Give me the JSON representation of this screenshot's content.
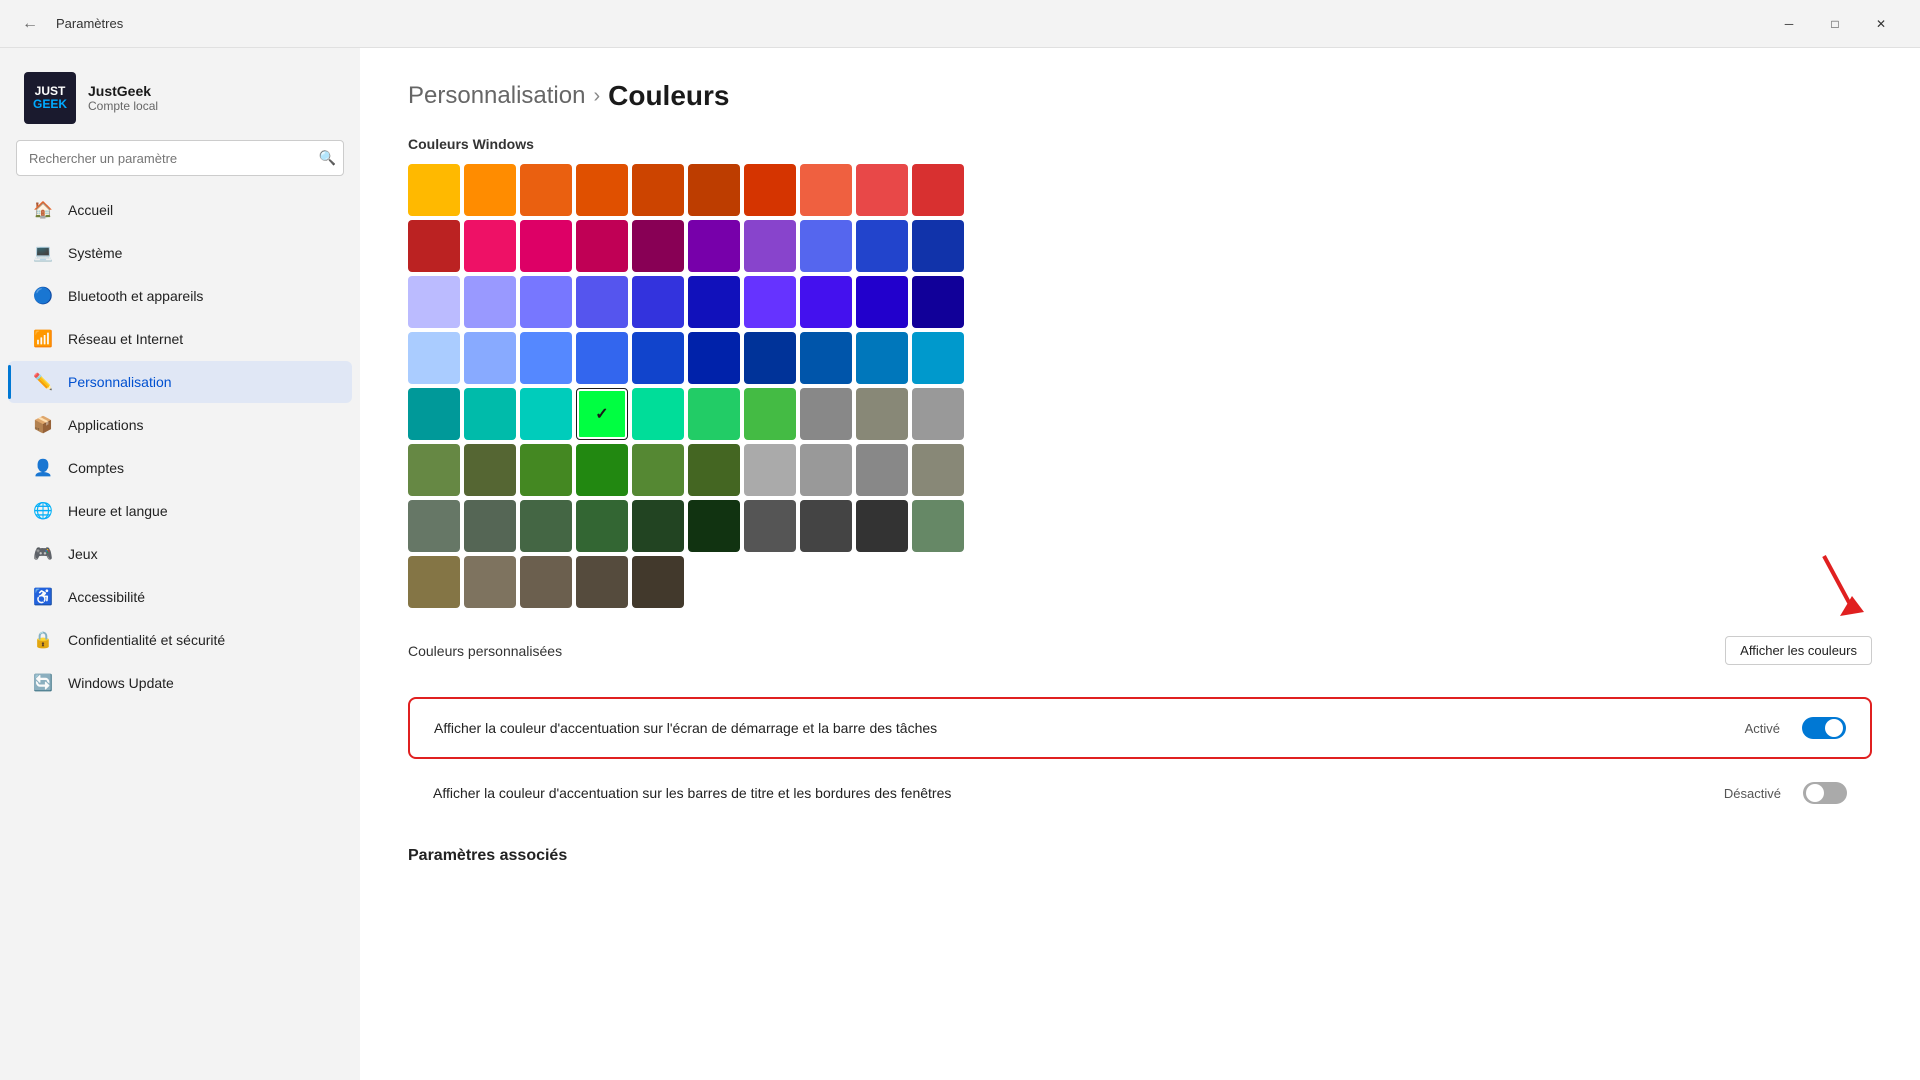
{
  "titleBar": {
    "title": "Paramètres",
    "backIcon": "←",
    "minimizeIcon": "─",
    "maximizeIcon": "□",
    "closeIcon": "✕"
  },
  "sidebar": {
    "logo": {
      "just": "JUST",
      "geek": "GEEK"
    },
    "profile": {
      "name": "JustGeek",
      "subtitle": "Compte local"
    },
    "search": {
      "placeholder": "Rechercher un paramètre"
    },
    "navItems": [
      {
        "id": "accueil",
        "label": "Accueil",
        "icon": "🏠"
      },
      {
        "id": "systeme",
        "label": "Système",
        "icon": "💻"
      },
      {
        "id": "bluetooth",
        "label": "Bluetooth et appareils",
        "icon": "🔵"
      },
      {
        "id": "reseau",
        "label": "Réseau et Internet",
        "icon": "📶"
      },
      {
        "id": "personnalisation",
        "label": "Personnalisation",
        "icon": "✏️",
        "active": true
      },
      {
        "id": "applications",
        "label": "Applications",
        "icon": "📦"
      },
      {
        "id": "comptes",
        "label": "Comptes",
        "icon": "👤"
      },
      {
        "id": "heure",
        "label": "Heure et langue",
        "icon": "🌐"
      },
      {
        "id": "jeux",
        "label": "Jeux",
        "icon": "🎮"
      },
      {
        "id": "accessibilite",
        "label": "Accessibilité",
        "icon": "♿"
      },
      {
        "id": "confidentialite",
        "label": "Confidentialité et sécurité",
        "icon": "🔒"
      },
      {
        "id": "windows-update",
        "label": "Windows Update",
        "icon": "🔄"
      }
    ]
  },
  "main": {
    "breadcrumb": {
      "parent": "Personnalisation",
      "separator": "›",
      "current": "Couleurs"
    },
    "windowsColorsTitle": "Couleurs Windows",
    "customColorsTitle": "Couleurs personnalisées",
    "customColorsBtn": "Afficher les couleurs",
    "toggleRow1": {
      "text": "Afficher la couleur d'accentuation sur l'écran de démarrage et la barre des tâches",
      "statusLabel": "Activé",
      "state": "on",
      "highlighted": true
    },
    "toggleRow2": {
      "text": "Afficher la couleur d'accentuation sur les barres de titre et les bordures des fenêtres",
      "statusLabel": "Désactivé",
      "state": "off",
      "highlighted": false
    },
    "relatedTitle": "Paramètres associés"
  },
  "colors": {
    "swatches": [
      "#FFB900",
      "#FF8C00",
      "#E65C00",
      "#C75000",
      "#BF4B00",
      "#BF6A00",
      "#C04040",
      "#E84343",
      "#E84040",
      "#D43535",
      "#C62B2B",
      "#B52525",
      "#FF3535",
      "#FF1E9B",
      "#D4006E",
      "#B8005B",
      "#A0004D",
      "#8A0040",
      "#FF85FF",
      "#FF40FF",
      "#D000D0",
      "#A000A0",
      "#800080",
      "#5A005A",
      "#8888FF",
      "#4444FF",
      "#0000FF",
      "#0000B8",
      "#0000A0",
      "#AACCFF",
      "#6699FF",
      "#4477FF",
      "#1144DD",
      "#0033AA",
      "#002299",
      "#AA88FF",
      "#8855FF",
      "#6633FF",
      "#5522DD",
      "#4411BB",
      "#330099",
      "#88FFFF",
      "#55FFFF",
      "#00CCCC",
      "#009999",
      "#007777",
      "#005555",
      "#55CCBB",
      "#33AA99",
      "#009988",
      "#007766",
      "#006655",
      "#004444",
      "#88FF99",
      "#55FF77",
      "#00DD55",
      "#00BB44",
      "#009933",
      "#007722",
      "#22CC55",
      "#00FF41",
      "#00E000",
      "#00B800",
      "#009000",
      "#006800",
      "#99CC66",
      "#77AA44",
      "#558822",
      "#336600",
      "#224400",
      "#112200",
      "#AAAAAA",
      "#909090",
      "#777777",
      "#606060",
      "#4A4A4A",
      "#333333",
      "#BBBBAA",
      "#AAAAAA",
      "#888877",
      "#666655",
      "#555544",
      "#444433",
      "#AABB99",
      "#99AA88",
      "#778866",
      "#556644",
      "#334422",
      "#223311",
      "#667766",
      "#887766",
      "#776655",
      "#665544",
      "#554433",
      "#443322",
      "#778866",
      "#998855",
      "#887744",
      "#665533",
      "#554422",
      "#443311",
      "#556666",
      "#667755",
      "#778855",
      "#667744",
      "#556644",
      "#445533"
    ],
    "selectedIndex": 43,
    "swatchColors": [
      "#FFB900",
      "#FF8C00",
      "#EA6010",
      "#CB4A00",
      "#BF4400",
      "#B84B00",
      "#DA3B01",
      "#EF6950",
      "#FF4343",
      "#D13438",
      "#FF0000",
      "#E74856",
      "#E3008C",
      "#EA005E",
      "#C30052",
      "#F7630C",
      "#CA5010",
      "#DA3B01",
      "#EF6950",
      "#FABB00",
      "#CA5010",
      "#FF8D00",
      "#E35800",
      "#DA3B01",
      "#EF6950",
      "#FF4343",
      "#D13438",
      "#FF1744",
      "#E81123",
      "#C50F1F",
      "#E74856",
      "#F7630C",
      "#EF6950",
      "#CA5010",
      "#DA3B01",
      "#FF8D00",
      "#E35800",
      "#CA5010",
      "#DA3B01",
      "#FF0000",
      "#C30052",
      "#E3008C",
      "#EA005E",
      "#9B0062",
      "#C239B3",
      "#9A0089",
      "#881798",
      "#744DA9",
      "#B146C2",
      "#0078D7",
      "#0099BC",
      "#2D7D9A",
      "#00B7C3",
      "#038387",
      "#00B294",
      "#018574",
      "#00CC6A",
      "#10893E",
      "#7A7574",
      "#5D5A58",
      "#68768A",
      "#515C6B",
      "#567C73",
      "#486860",
      "#498205",
      "#107C10",
      "#767676",
      "#4C4A48",
      "#69797E",
      "#4A5459",
      "#647C64",
      "#525E54",
      "#847545",
      "#7E735F"
    ]
  }
}
